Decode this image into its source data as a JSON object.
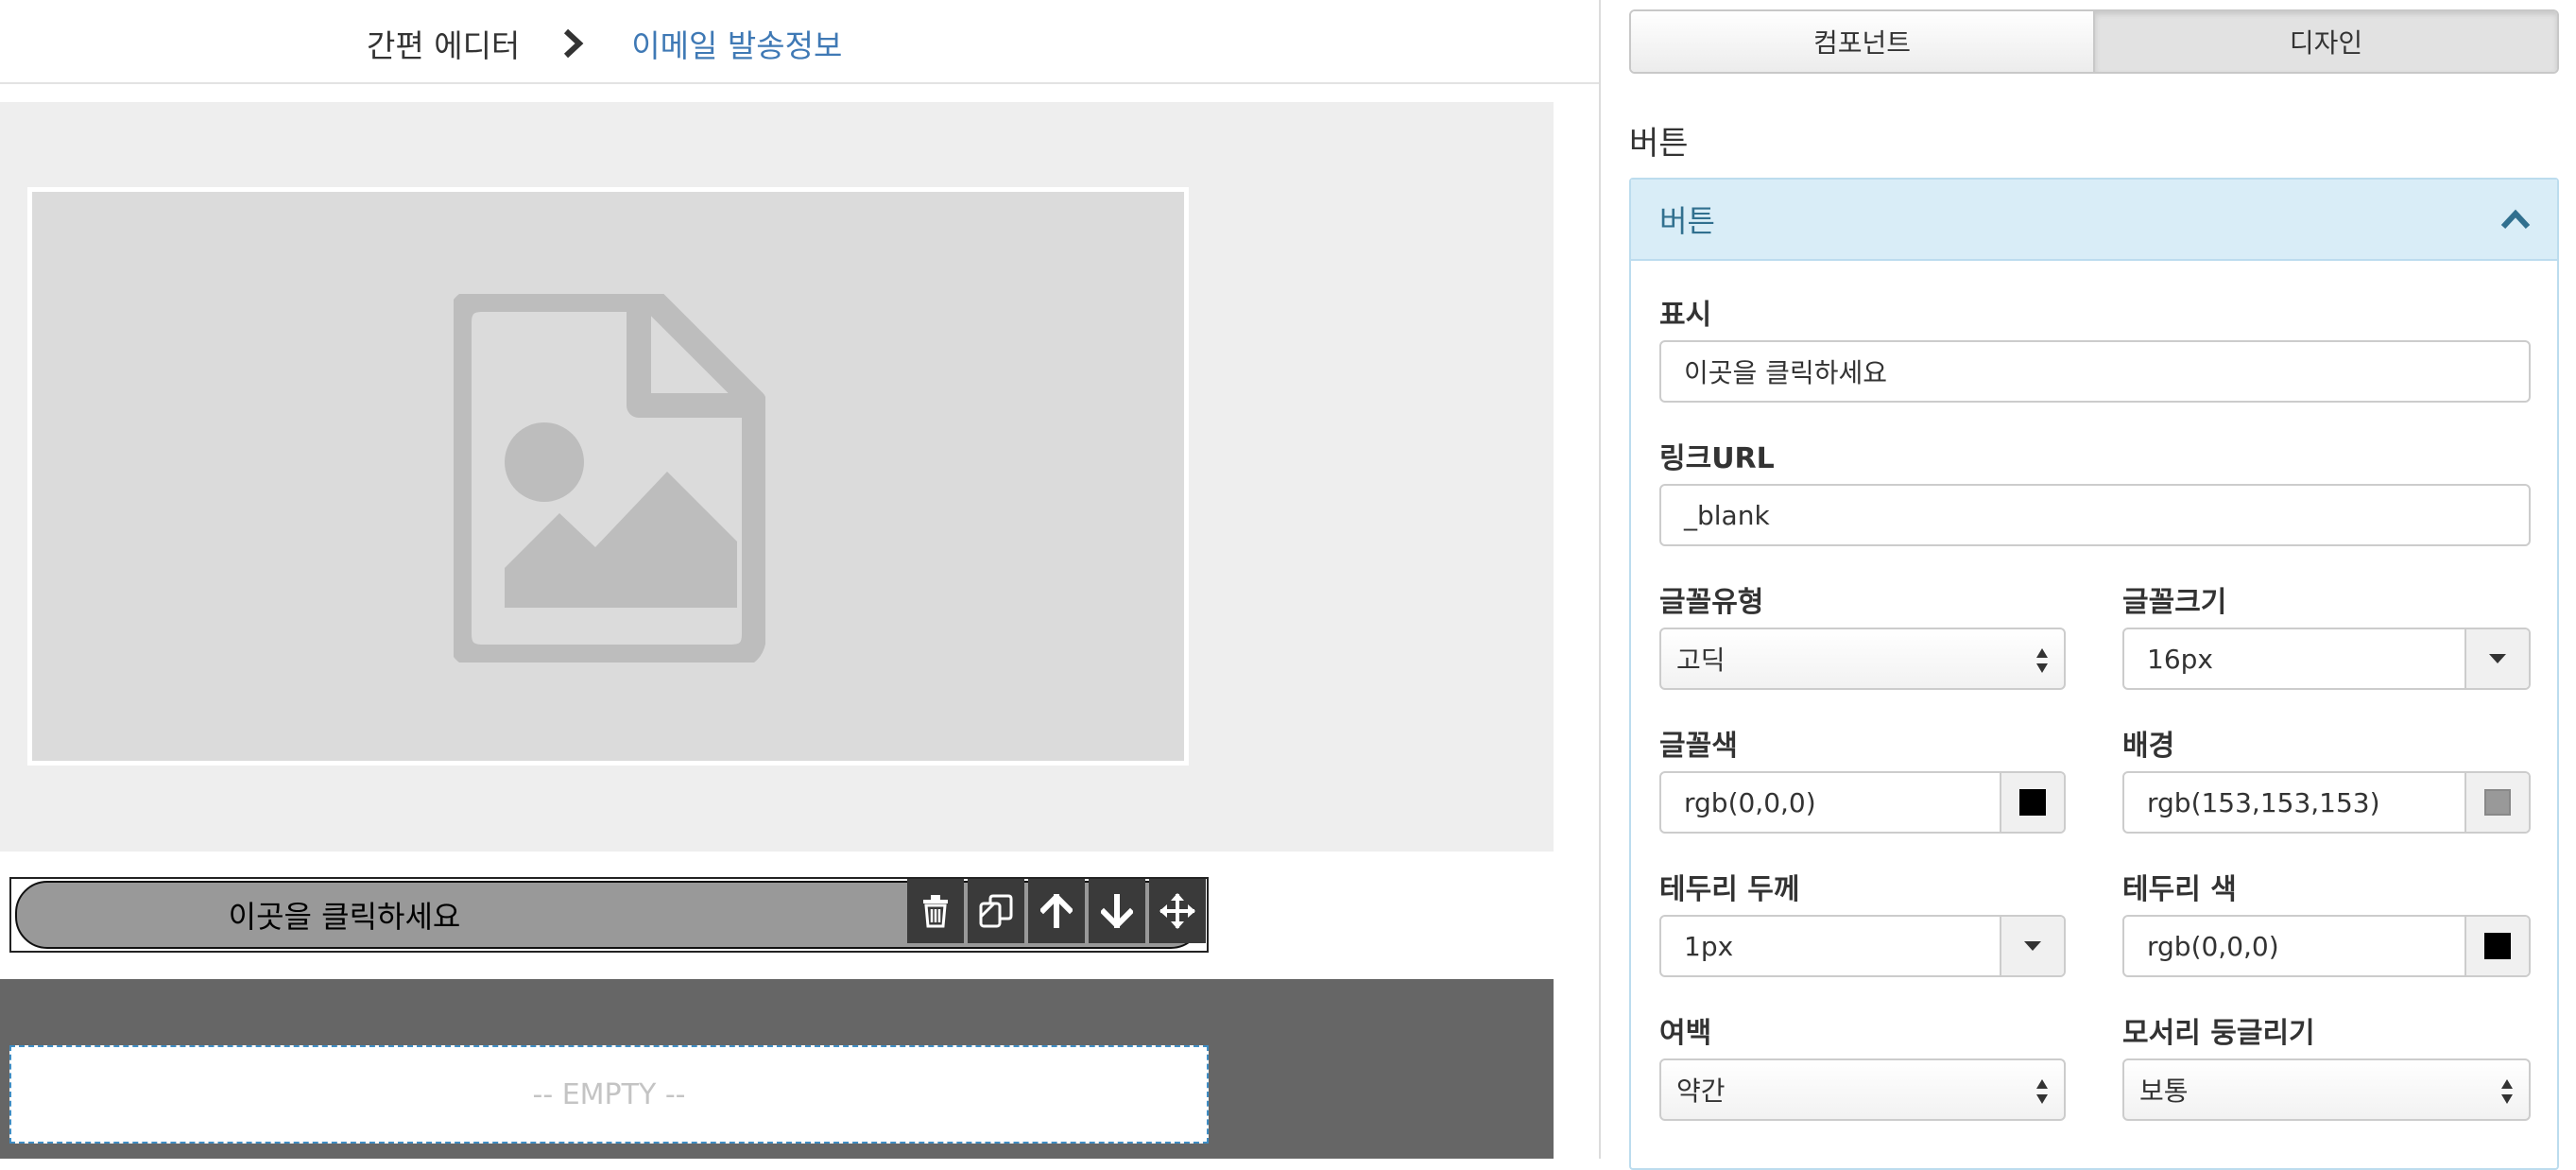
{
  "breadcrumb": {
    "root": "간편 에디터",
    "current": "이메일 발송정보"
  },
  "canvas": {
    "button_text": "이곳을 클릭하세요",
    "empty_text": "-- EMPTY --",
    "tools": [
      "trash-icon",
      "copy-icon",
      "arrow-up-icon",
      "arrow-down-icon",
      "move-icon"
    ]
  },
  "panel": {
    "tabs": [
      {
        "label": "컴포넌트"
      },
      {
        "label": "디자인"
      }
    ],
    "section_title": "버튼",
    "accordion_title": "버튼",
    "fields": {
      "display": {
        "label": "표시",
        "value": "이곳을 클릭하세요"
      },
      "link": {
        "label": "링크URL",
        "value": "_blank"
      },
      "font_type": {
        "label": "글꼴유형",
        "value": "고딕"
      },
      "font_size": {
        "label": "글꼴크기",
        "value": "16px"
      },
      "font_color": {
        "label": "글꼴색",
        "value": "rgb(0,0,0)",
        "swatch": "#000000"
      },
      "background": {
        "label": "배경",
        "value": "rgb(153,153,153)",
        "swatch": "#999999"
      },
      "border_width": {
        "label": "테두리 두께",
        "value": "1px"
      },
      "border_color": {
        "label": "테두리 색",
        "value": "rgb(0,0,0)",
        "swatch": "#000000"
      },
      "padding": {
        "label": "여백",
        "value": "약간"
      },
      "radius": {
        "label": "모서리 둥글리기",
        "value": "보통"
      }
    }
  },
  "colors": {
    "accent_link": "#3f79b5",
    "accordion_head": "#d9edf7",
    "dark_canvas": "#666666"
  }
}
